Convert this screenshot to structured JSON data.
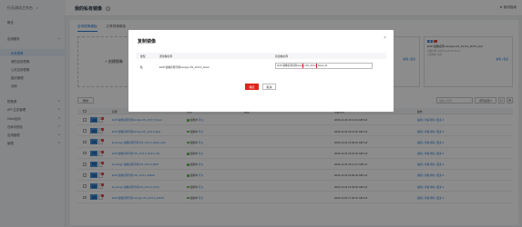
{
  "app": {
    "title": "行天测试工作台",
    "page_title": "我的私有镜像",
    "top_right": "⚙ 使用指南"
  },
  "sidebar": {
    "items": [
      {
        "label": "概览"
      },
      {
        "label": "应用服务"
      },
      {
        "label": "私有镜像"
      },
      {
        "label": "我的应用镜像"
      },
      {
        "label": "公共应用镜像"
      },
      {
        "label": "组织管理"
      },
      {
        "label": "仓库"
      },
      {
        "label": "镜像源"
      },
      {
        "label": "API 生态管理"
      },
      {
        "label": "Helm应用"
      },
      {
        "label": "仓库可视化"
      },
      {
        "label": "应用管理"
      },
      {
        "label": "管理"
      }
    ]
  },
  "tabs": [
    {
      "label": "自有镜像模板"
    },
    {
      "label": "共享镜像模板"
    }
  ],
  "add_card": {
    "label": "+ 创建镜像"
  },
  "cards": [
    {
      "caption": "EXP-镜像名称示例-OS_V5a_ub4",
      "sub1": "创建时间: 2023-10-24 16:13:31",
      "sub2": "● 使用中  可用",
      "links": "编辑 | 更多"
    },
    {
      "caption": "EXP-镜像名称-osmigu-OS_23.6.0_SixTU_tbd",
      "sub1": "创建时间: 2023-10-24 16:13:31",
      "sub2": "● 使用中  可用",
      "links": "编辑 | 更多"
    }
  ],
  "toolbar": {
    "delete_label": "删除",
    "search_placeholder": "请输入名称",
    "select_label": "所有资源",
    "refresh": "C",
    "settings": "⚙"
  },
  "table": {
    "headers": {
      "name": "名称",
      "status": "状态",
      "remark": "备注",
      "time": "创建时间",
      "ops": "操作"
    },
    "rows": [
      {
        "name": "EXP-镜像名称示例osmigu OS_23.6.0_Nov2",
        "status": "使用中",
        "ext": "可以",
        "time": "2023-10-24 16:13:31 GMT+8",
        "ops": "编辑 | 查看详情 | 更多 ▾"
      },
      {
        "name": "EXP-镜像名称示例osmigu OS_23.6.0_Bed",
        "status": "使用中",
        "ext": "可以",
        "time": "2023-10-24 16:13:22 GMT+8",
        "ops": "编辑 | 查看详情 | 更多 ▾"
      },
      {
        "name": "E-osmigu 镜像名称示例 OS_23.6.0_Rflow_dlx0",
        "status": "使用中",
        "ext": "可以",
        "time": "2023-10-24 15:09:10 GMT+8",
        "ops": "编辑 | 查看详情 | 更多 ▾"
      },
      {
        "name": "EXP-镜像名称示例 OS_23.6.0_SixTU_tbd",
        "status": "使用中",
        "ext": "可以",
        "time": "2023-10-24 16:16:03 GMT+8",
        "ops": "编辑 | 查看详情 | 更多 ▾"
      },
      {
        "name": "E-osmigu 镜像名称示例 OS_23.6.0_Bfd3",
        "status": "使用中",
        "ext": "可以",
        "time": "2023-10-24 15:11:17 GMT+8",
        "ops": "编辑 | 查看详情 | 更多 ▾"
      },
      {
        "name": "EXP-镜像名称示例 OS_23.6.0_Bdbcb",
        "status": "使用中",
        "ext": "可以",
        "time": "2023-10-23 15:59:29 GMT+8",
        "ops": "编辑 | 查看详情 | 更多 ▾"
      },
      {
        "name": "E-osmigu 镜像名称示例 OS_23.6.0_FTbw",
        "status": "使用中",
        "ext": "可以",
        "time": "2023-10-23 13:49:49 GMT+8",
        "ops": "编辑 | 查看详情 | 更多 ▾"
      },
      {
        "name": "EXP-镜像名称示例 osmigu OS_23.6.0_3aTZ3",
        "status": "使用中",
        "ext": "可以",
        "time": "2023-10-02 17:45:01 GMT+8",
        "ops": "编辑 | 查看详情 | 更多 ▾"
      }
    ]
  },
  "modal": {
    "title": "复制镜像",
    "close": "×",
    "headers": {
      "type": "类型",
      "source": "源镜像名称",
      "target": "新镜像名称"
    },
    "row": {
      "type": "私",
      "source": "EXP-镜像名称示例osmigu OS_23.6.0_Nov2",
      "target": "EXP-镜像名称示例osmigu OS_23.6.0_Nov2_01"
    },
    "ok_label": "确定",
    "cancel_label": "取消"
  },
  "colors": {
    "accent": "#2a7bd6",
    "danger": "#e2231a",
    "success": "#5bb54b"
  }
}
